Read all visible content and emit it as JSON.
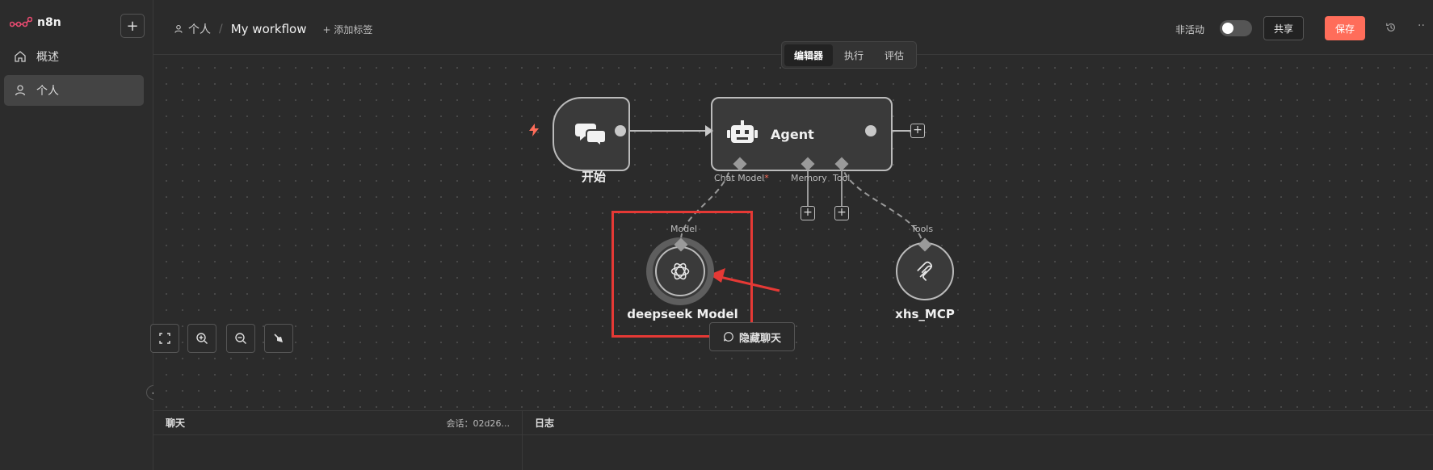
{
  "app": {
    "name": "n8n"
  },
  "sidebar": {
    "add_label": "+",
    "items": [
      {
        "label": "概述",
        "icon": "home-icon"
      },
      {
        "label": "个人",
        "icon": "user-icon"
      }
    ]
  },
  "header": {
    "owner": "个人",
    "separator": "/",
    "workflow_name": "My workflow",
    "add_tag": "+ 添加标签",
    "inactive_label": "非活动",
    "share_label": "共享",
    "save_label": "保存",
    "more_label": "··"
  },
  "tabs": [
    {
      "label": "编辑器",
      "active": true
    },
    {
      "label": "执行",
      "active": false
    },
    {
      "label": "评估",
      "active": false
    }
  ],
  "nodes": {
    "trigger": {
      "label": "开始"
    },
    "agent": {
      "label": "Agent",
      "sub_ports": {
        "chat_model": "Chat Model",
        "required_mark": "*",
        "memory": "Memory",
        "tool": "Tool"
      }
    },
    "model": {
      "label": "deepseek Model",
      "port_label": "Model"
    },
    "mcp": {
      "label": "xhs_MCP",
      "port_label": "Tools"
    }
  },
  "controls": {
    "chat_toggle": "隐藏聊天"
  },
  "bottom": {
    "chat_title": "聊天",
    "session": "会话：02d26...",
    "log_title": "日志"
  },
  "colors": {
    "accent": "#ff6d5a",
    "highlight": "#e53935"
  }
}
